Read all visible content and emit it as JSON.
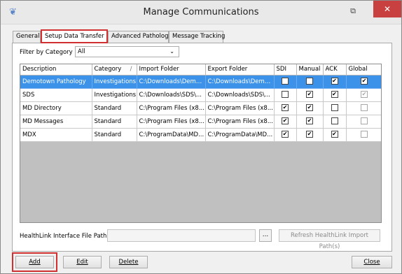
{
  "window": {
    "title": "Manage Communications",
    "restore_glyph": "⧉",
    "close_glyph": "✕"
  },
  "tabs": [
    "General",
    "Setup Data Transfer",
    "Advanced Pathology",
    "Message Tracking"
  ],
  "filter": {
    "label": "Filter by Category",
    "value": "All"
  },
  "grid": {
    "columns": [
      "Description",
      "Category",
      "Import Folder",
      "Export Folder",
      "SDI",
      "Manual",
      "ACK",
      "Global"
    ],
    "sort_glyph": "/",
    "rows": [
      {
        "description": "Demotown Pathology",
        "category": "Investigations",
        "import": "C:\\Downloads\\Demo...",
        "export": "C:\\Downloads\\Demo...",
        "sdi": false,
        "manual": false,
        "ack": true,
        "global": true,
        "global_disabled": false,
        "selected": true
      },
      {
        "description": "SDS",
        "category": "Investigations",
        "import": "C:\\Downloads\\SDS\\...",
        "export": "C:\\Downloads\\SDS\\...",
        "sdi": false,
        "manual": true,
        "ack": true,
        "global": true,
        "global_disabled": true,
        "selected": false
      },
      {
        "description": "MD Directory",
        "category": "Standard",
        "import": "C:\\Program Files (x8...",
        "export": "C:\\Program Files (x8...",
        "sdi": true,
        "manual": true,
        "ack": false,
        "global": false,
        "global_disabled": true,
        "selected": false
      },
      {
        "description": "MD Messages",
        "category": "Standard",
        "import": "C:\\Program Files (x8...",
        "export": "C:\\Program Files (x8...",
        "sdi": true,
        "manual": true,
        "ack": false,
        "global": false,
        "global_disabled": true,
        "selected": false
      },
      {
        "description": "MDX",
        "category": "Standard",
        "import": "C:\\ProgramData\\MD...",
        "export": "C:\\ProgramData\\MD...",
        "sdi": true,
        "manual": true,
        "ack": true,
        "global": false,
        "global_disabled": true,
        "selected": false
      }
    ]
  },
  "healthlink": {
    "label": "HealthLink Interface File Path",
    "browse_label": "...",
    "refresh_label": "Refresh HealthLink Import Path(s)"
  },
  "buttons": {
    "add": "Add",
    "edit": "Edit",
    "delete": "Delete",
    "close": "Close"
  },
  "colors": {
    "selection": "#3b92e8",
    "highlight": "#d03030",
    "close_bg": "#c84040"
  }
}
